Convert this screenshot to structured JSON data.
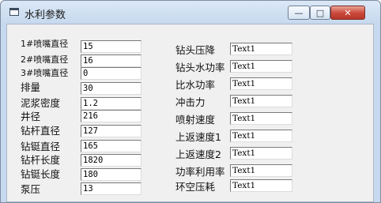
{
  "window": {
    "title": "水利参数",
    "controls": {
      "minimize": "—",
      "maximize": "□",
      "close": "✕"
    }
  },
  "left_fields": [
    {
      "label": "1#喷嘴直径",
      "value": "15"
    },
    {
      "label": "2#喷嘴直径",
      "value": "16"
    },
    {
      "label": "3#喷嘴直径",
      "value": "0"
    },
    {
      "label": "排量",
      "value": "30"
    },
    {
      "label": "泥浆密度",
      "value": "1.2"
    },
    {
      "label": "井径",
      "value": "216"
    },
    {
      "label": "钻杆直径",
      "value": "127"
    },
    {
      "label": "钻铤直径",
      "value": "165"
    },
    {
      "label": "钻杆长度",
      "value": "1820"
    },
    {
      "label": "钻铤长度",
      "value": "180"
    },
    {
      "label": "泵压",
      "value": "13"
    }
  ],
  "right_fields": [
    {
      "label": "钻头压降",
      "value": "Text1"
    },
    {
      "label": "钻头水功率",
      "value": "Text1"
    },
    {
      "label": "比水功率",
      "value": "Text1"
    },
    {
      "label": "冲击力",
      "value": "Text1"
    },
    {
      "label": "喷射速度",
      "value": "Text1"
    },
    {
      "label": "上返速度1",
      "value": "Text1"
    },
    {
      "label": "上返速度2",
      "value": "Text1"
    },
    {
      "label": "功率利用率",
      "value": "Text1"
    },
    {
      "label": "环空压耗",
      "value": "Text1"
    }
  ]
}
